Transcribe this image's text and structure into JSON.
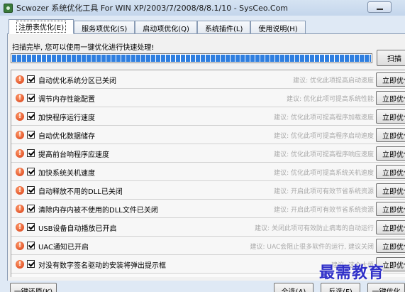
{
  "window": {
    "title": "Scwozer 系统优化工具 For WIN XP/2003/7/2008/8/8.1/10 - SysCeo.Com"
  },
  "tabs": [
    {
      "label": "注册表优化(E)",
      "active": true
    },
    {
      "label": "服务项优化(S)",
      "active": false
    },
    {
      "label": "启动项优化(Q)",
      "active": false
    },
    {
      "label": "系统插件(L)",
      "active": false
    },
    {
      "label": "使用说明(H)",
      "active": false
    }
  ],
  "status": {
    "text": "扫描完毕, 您可以使用一键优化进行快速处理!",
    "progress_percent": 100,
    "scan_label": "扫描"
  },
  "items": [
    {
      "label": "自动优化系统分区已关闭",
      "suggestion": "建议: 优化此项提高启动速度",
      "button": "立即优化",
      "checked": true
    },
    {
      "label": "调节内存性能配置",
      "suggestion": "建议: 优化此项可提高系统性能",
      "button": "立即优化",
      "checked": true
    },
    {
      "label": "加快程序运行速度",
      "suggestion": "建议: 优化此项可提高程序加载速度",
      "button": "立即优化",
      "checked": true
    },
    {
      "label": "自动优化数据储存",
      "suggestion": "建议: 优化此项可提高程序启动速度",
      "button": "立即优化",
      "checked": true
    },
    {
      "label": "提高前台响程序应速度",
      "suggestion": "建议: 优化此项可提高程序响应速度",
      "button": "立即优化",
      "checked": true
    },
    {
      "label": "加快系统关机速度",
      "suggestion": "建议: 优化此项可提高系统关机速度",
      "button": "立即优化",
      "checked": true
    },
    {
      "label": "自动释放不用的DLL已关闭",
      "suggestion": "建议: 开启此项可有效节省系统资源",
      "button": "立即优化",
      "checked": true
    },
    {
      "label": "清除内存内被不使用的DLL文件已关闭",
      "suggestion": "建议: 开启此项可有效节省系统资源",
      "button": "立即优化",
      "checked": true
    },
    {
      "label": "USB设备自动播放已开启",
      "suggestion": "建议: 关闭此项可有效防止病毒的自动运行",
      "button": "立即优化",
      "checked": true
    },
    {
      "label": "UAC通知已开启",
      "suggestion": "建议: UAC会阻止很多软件的运行, 建议关闭",
      "button": "立即优化",
      "checked": true
    },
    {
      "label": "对没有数字签名驱动的安装将弹出提示框",
      "suggestion": "建议: 这个太烦",
      "button": "立即优化",
      "checked": true
    }
  ],
  "bottom": {
    "restore_label": "一键还原(K)",
    "select_all_label": "全选(A)",
    "invert_label": "反选(F)",
    "one_click_label": "一键优化"
  },
  "watermark": "最需教育",
  "colors": {
    "progress": "#2f7fe0",
    "alert": "#d63a12",
    "watermark": "#2f2fc8"
  }
}
